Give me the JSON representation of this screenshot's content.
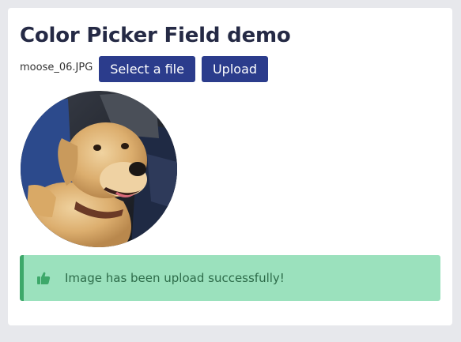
{
  "page": {
    "title": "Color Picker Field demo"
  },
  "file": {
    "name": "moose_06.JPG",
    "select_label": "Select a file",
    "upload_label": "Upload"
  },
  "preview": {
    "alt": "dog photo preview"
  },
  "alert": {
    "icon": "thumbs-up-icon",
    "message": "Image has been upload successfully!"
  },
  "colors": {
    "button": "#2b3c8c",
    "alert_bg": "#9be1bd",
    "alert_border": "#3da86a",
    "alert_text": "#2d6b49"
  }
}
